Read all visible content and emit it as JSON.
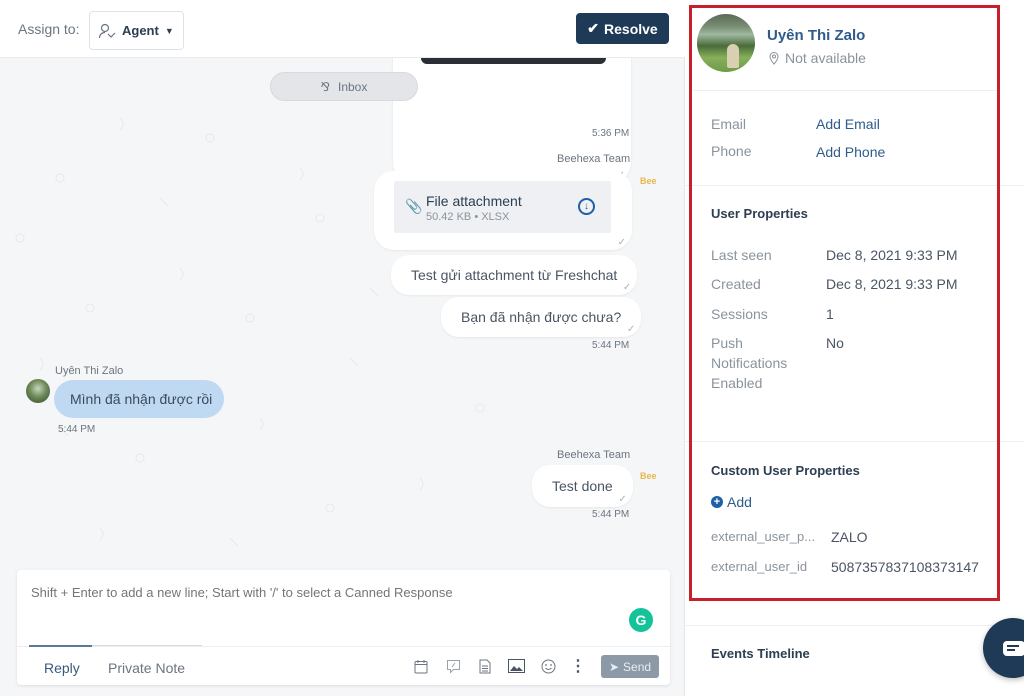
{
  "header": {
    "assign_label": "Assign to:",
    "agent_label": "Agent",
    "resolve_label": "Resolve"
  },
  "feed": {
    "inbox_pill": "Inbox",
    "messages": [
      {
        "type": "image",
        "from": "agent",
        "time": "5:36 PM"
      },
      {
        "type": "file",
        "from": "agent",
        "sender": "Beehexa Team",
        "file_name": "File attachment",
        "file_meta": "50.42 KB • XLSX"
      },
      {
        "type": "text",
        "from": "agent",
        "text": "Test gửi attachment từ Freshchat"
      },
      {
        "type": "text",
        "from": "agent",
        "text": "Bạn đã nhận được chưa?",
        "time": "5:44 PM"
      },
      {
        "type": "text",
        "from": "user",
        "sender": "Uyên Thi Zalo",
        "text": "Mình đã nhận được rồi",
        "time": "5:44 PM"
      },
      {
        "type": "text",
        "from": "agent",
        "sender": "Beehexa Team",
        "text": "Test done",
        "time": "5:44 PM"
      }
    ],
    "bot_tag": "Bee"
  },
  "composer": {
    "placeholder": "Shift + Enter to add a new line; Start with '/' to select a Canned Response",
    "tabs": [
      "Reply",
      "Private Note"
    ],
    "active_tab": "Reply",
    "tools": [
      "calendar-icon",
      "canned-response-icon",
      "article-icon",
      "image-icon",
      "emoji-icon",
      "more-icon"
    ],
    "send_label": "Send"
  },
  "profile": {
    "name": "Uyên Thi Zalo",
    "location": "Not available",
    "contact": [
      {
        "label": "Email",
        "value": "Add Email"
      },
      {
        "label": "Phone",
        "value": "Add Phone"
      }
    ],
    "user_properties_title": "User Properties",
    "user_properties": [
      {
        "label": "Last seen",
        "value": "Dec 8, 2021 9:33 PM"
      },
      {
        "label": "Created",
        "value": "Dec 8, 2021 9:33 PM"
      },
      {
        "label": "Sessions",
        "value": "1"
      },
      {
        "label": "Push Notifications Enabled",
        "value": "No"
      }
    ],
    "custom_title": "Custom User Properties",
    "add_label": "Add",
    "custom_properties": [
      {
        "label": "external_user_p...",
        "value": "ZALO"
      },
      {
        "label": "external_user_id",
        "value": "5087357837108373147"
      }
    ],
    "events_title": "Events Timeline"
  },
  "colors": {
    "primary": "#1e3a56",
    "link": "#2f5b8c",
    "highlight_box": "#c8202a",
    "user_bubble": "#bfd9f2"
  }
}
